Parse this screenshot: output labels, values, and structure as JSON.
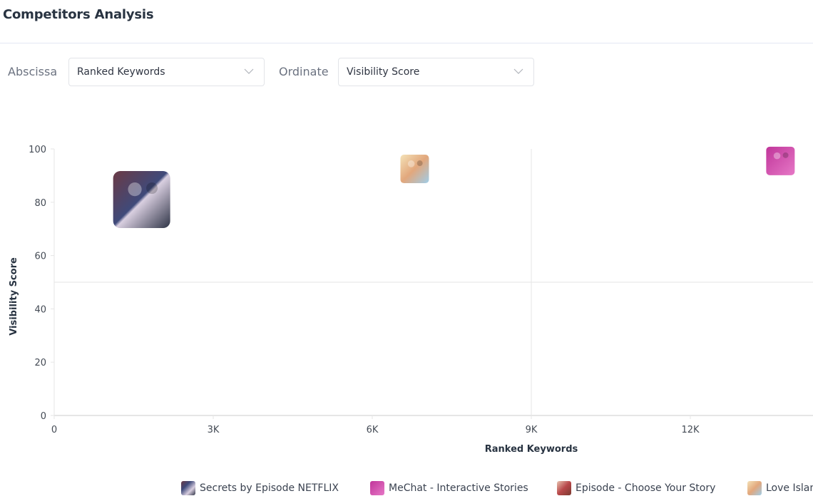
{
  "header": {
    "title": "Competitors Analysis"
  },
  "controls": {
    "abscissa_label": "Abscissa",
    "abscissa_value": "Ranked Keywords",
    "ordinate_label": "Ordinate",
    "ordinate_value": "Visibility Score"
  },
  "chart_data": {
    "type": "scatter",
    "title": "",
    "xlabel": "Ranked Keywords",
    "ylabel": "Visibility Score",
    "xlim": [
      0,
      14000
    ],
    "ylim": [
      0,
      100
    ],
    "x_ticks": [
      0,
      3000,
      6000,
      9000,
      12000
    ],
    "x_tick_labels": [
      "0",
      "3K",
      "6K",
      "9K",
      "12K"
    ],
    "y_ticks": [
      0,
      20,
      40,
      60,
      80,
      100
    ],
    "y_tick_labels": [
      "0",
      "20",
      "40",
      "60",
      "80",
      "100"
    ],
    "quadrant_lines": {
      "x": 9000,
      "y": 50
    },
    "grid": false,
    "legend_position": "bottom",
    "points": [
      {
        "name": "Secrets by Episode NETFLIX",
        "x": 1650,
        "y": 81,
        "icon": "secrets-app-icon",
        "highlighted": true
      },
      {
        "name": "Love Island",
        "x": 6800,
        "y": 92.5,
        "icon": "love-island-app-icon",
        "highlighted": false
      },
      {
        "name": "MeChat - Interactive Stories",
        "x": 13700,
        "y": 95.5,
        "icon": "mechat-app-icon",
        "highlighted": false
      }
    ],
    "legend": [
      {
        "label": "Secrets by Episode NETFLIX",
        "icon": "secrets-app-icon"
      },
      {
        "label": "MeChat - Interactive Stories",
        "icon": "mechat-app-icon"
      },
      {
        "label": "Episode - Choose Your Story",
        "icon": "episode-app-icon"
      },
      {
        "label": "Love Islan",
        "icon": "love-island-app-icon"
      }
    ]
  },
  "colors": {
    "axis": "#e6e6e6",
    "secrets_icon": [
      "#5a3a4a",
      "#c9b7c9",
      "#2d3346"
    ],
    "love_island_icon": [
      "#f0c79a",
      "#8fc3e8",
      "#c88964"
    ],
    "mechat_icon": [
      "#c2399c",
      "#e070c0",
      "#f2e8f0"
    ],
    "episode_icon": [
      "#b8484a",
      "#e6b8a0",
      "#7a3a30"
    ]
  }
}
